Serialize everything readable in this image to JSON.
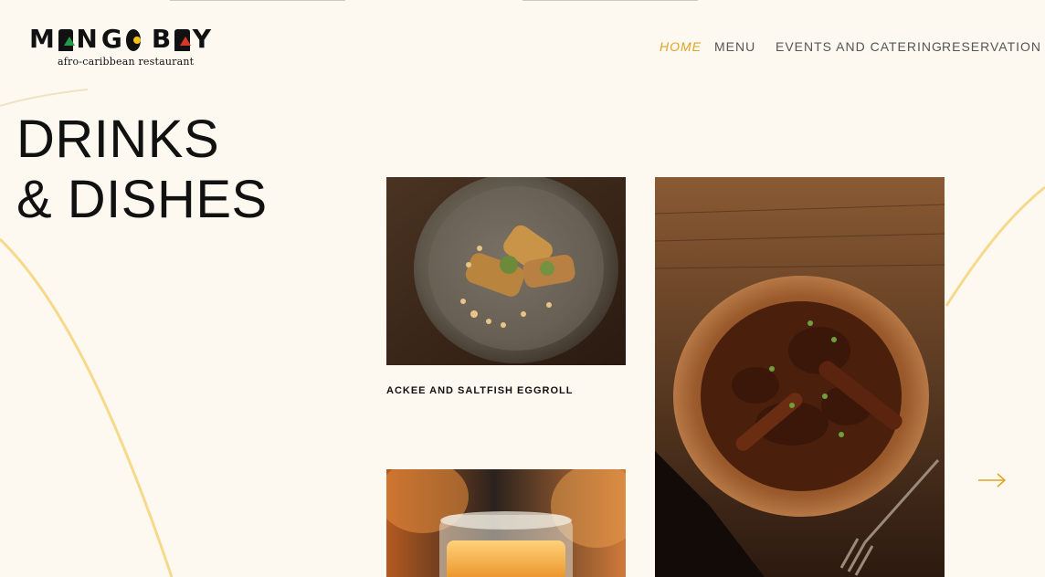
{
  "brand": {
    "name": "MANGO BAY",
    "tagline": "afro-caribbean restaurant",
    "accent_colors": [
      "#1f9b4a",
      "#f2c21b",
      "#d8382b"
    ]
  },
  "nav": {
    "items": [
      {
        "label": "HOME",
        "active": true
      },
      {
        "label": "MENU",
        "active": false
      },
      {
        "label": "EVENTS AND CATERING",
        "active": false
      },
      {
        "label": "RESERVATION",
        "active": false
      }
    ],
    "active_color": "#e0a423"
  },
  "hero": {
    "heading_line1": "DRINKS",
    "heading_line2": "& DISHES"
  },
  "gallery": {
    "items": [
      {
        "caption": "ACKEE AND SALTFISH EGGROLL",
        "image": "eggroll-dish-photo"
      },
      {
        "caption": "",
        "image": "stewed-meat-bowl-photo"
      },
      {
        "caption": "",
        "image": "orange-cocktail-photo"
      }
    ],
    "next_icon": "arrow-right-icon"
  },
  "colors": {
    "background": "#fdf9f1",
    "curve": "#f6d98a"
  }
}
